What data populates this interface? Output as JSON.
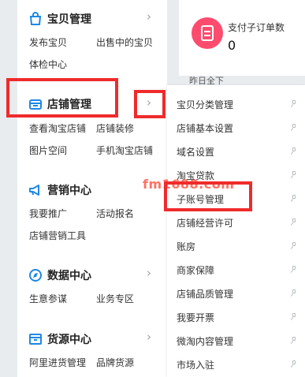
{
  "sections": {
    "baobei": {
      "title": "宝贝管理",
      "items": [
        "发布宝贝",
        "出售中的宝贝",
        "体检中心"
      ]
    },
    "dianpu": {
      "title": "店铺管理",
      "items": [
        "查看淘宝店铺",
        "店铺装修",
        "图片空间",
        "手机淘宝店铺"
      ]
    },
    "yingxiao": {
      "title": "营销中心",
      "items": [
        "我要推广",
        "活动报名",
        "店铺营销工具"
      ]
    },
    "shuju": {
      "title": "数据中心",
      "items": [
        "生意参谋",
        "业务专区"
      ]
    },
    "huoyuan": {
      "title": "货源中心",
      "items": [
        "阿里进货管理",
        "品牌货源"
      ]
    }
  },
  "chevron": "›",
  "stat": {
    "label": "支付子订单数",
    "value": "0"
  },
  "peek_text": "昨日全下",
  "flyout": {
    "items": [
      "宝贝分类管理",
      "店铺基本设置",
      "域名设置",
      "淘宝贷款",
      "子账号管理",
      "店铺经营许可",
      "账房",
      "商家保障",
      "店铺品质管理",
      "我要开票",
      "微淘内容管理",
      "市场入驻"
    ]
  },
  "watermark": "fm1688.com",
  "colors": {
    "accent_blue": "#1e88e5",
    "stat_icon": "#ff4b6e",
    "highlight_red": "#ef2b2b"
  }
}
